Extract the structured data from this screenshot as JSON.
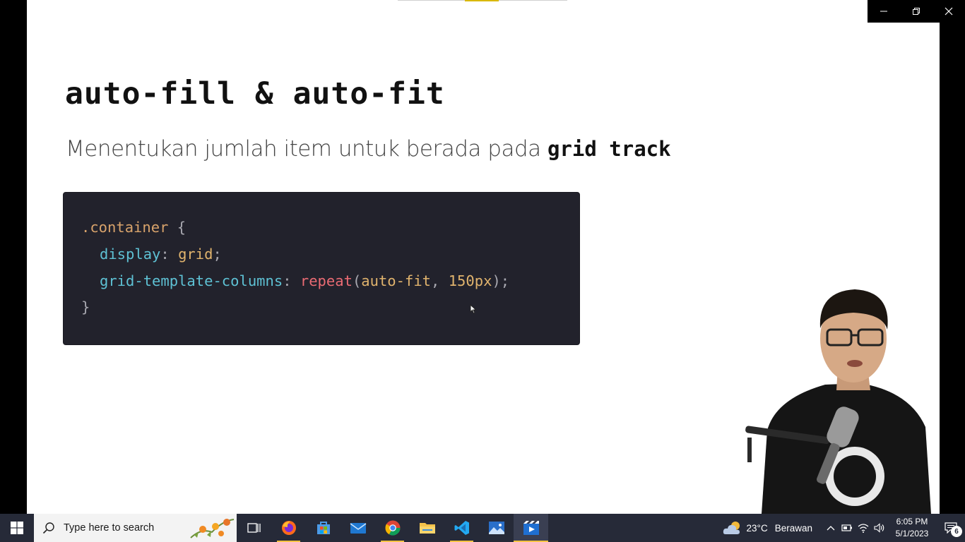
{
  "slide": {
    "title": "auto-fill & auto-fit",
    "subtitle_text": "Menentukan jumlah item untuk berada pada ",
    "subtitle_bold": "grid track",
    "code": {
      "line1_selector": ".container",
      "line1_brace": " {",
      "line2_prop": "display",
      "line2_colon": ": ",
      "line2_value": "grid",
      "line2_semi": ";",
      "line3_prop": "grid-template-columns",
      "line3_colon": ": ",
      "line3_func": "repeat",
      "line3_paren_open": "(",
      "line3_arg1": "auto-fit",
      "line3_comma": ", ",
      "line3_arg2": "150px",
      "line3_end": ");",
      "line4_brace": "}"
    }
  },
  "taskbar": {
    "search_placeholder": "Type here to search",
    "apps": [
      {
        "name": "task-view-icon"
      },
      {
        "name": "firefox-icon"
      },
      {
        "name": "microsoft-store-icon"
      },
      {
        "name": "mail-icon"
      },
      {
        "name": "chrome-icon"
      },
      {
        "name": "file-explorer-icon"
      },
      {
        "name": "vscode-icon"
      },
      {
        "name": "photos-icon"
      },
      {
        "name": "media-player-icon"
      }
    ],
    "weather": {
      "temp": "23°C",
      "desc": "Berawan"
    },
    "clock": {
      "time": "6:05 PM",
      "date": "5/1/2023"
    },
    "notification_count": "6"
  },
  "colors": {
    "accent_underline": "#f6c343",
    "taskbar_bg": "#262a38",
    "code_bg": "#22222c"
  }
}
